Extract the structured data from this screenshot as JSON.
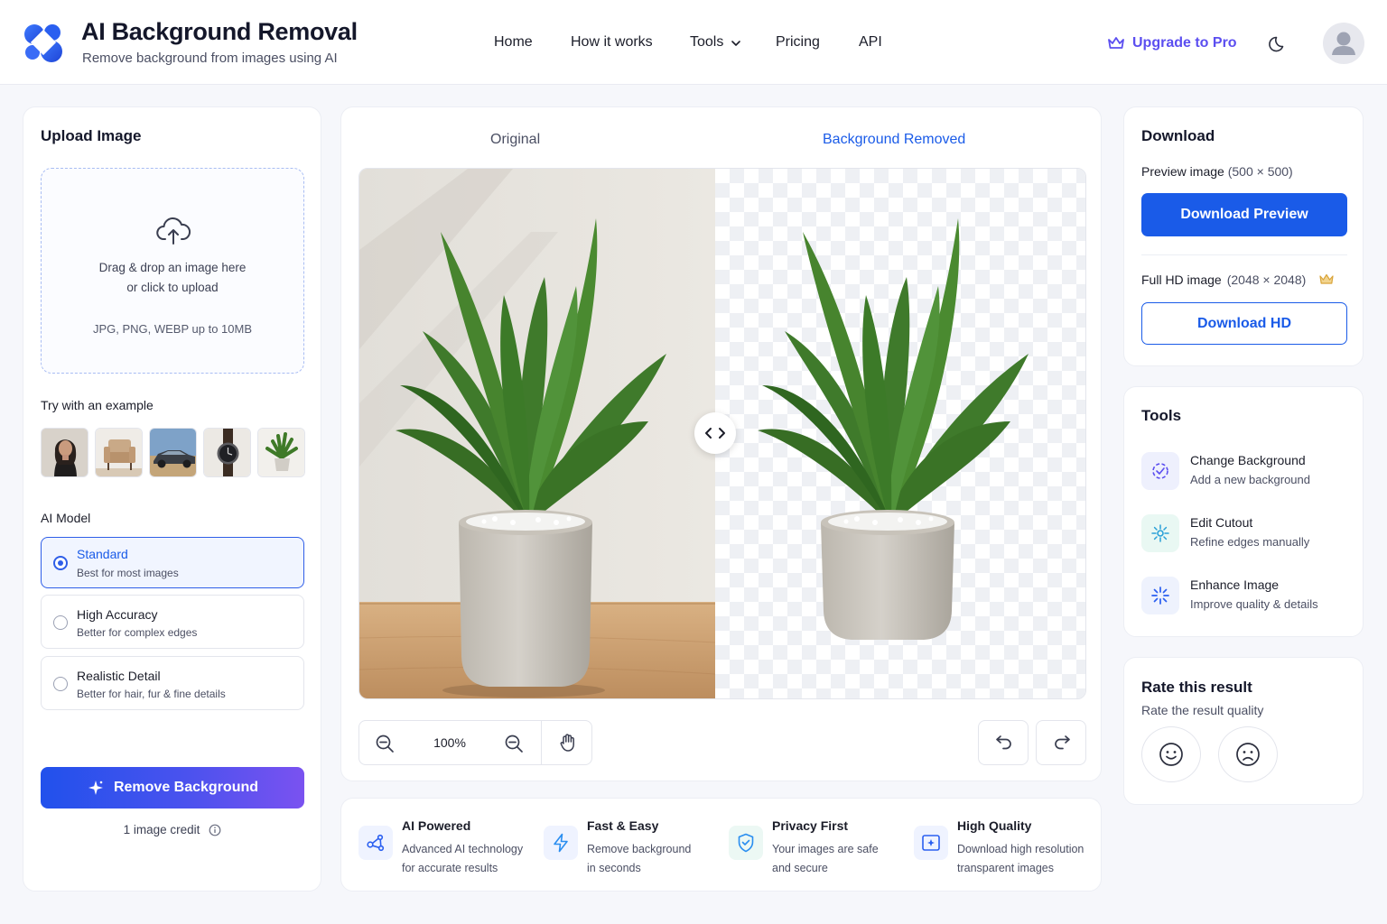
{
  "header": {
    "title": "AI Background Removal",
    "subtitle": "Remove background from images using AI",
    "nav": [
      {
        "label": "Home"
      },
      {
        "label": "How it works"
      },
      {
        "label": "Tools"
      },
      {
        "label": "Pricing"
      },
      {
        "label": "API"
      }
    ],
    "upgrade_label": "Upgrade to Pro",
    "accent_color": "#5b4ef0"
  },
  "upload": {
    "title": "Upload Image",
    "drop_line1": "Drag & drop an image here",
    "drop_line2": "or click to upload",
    "formats": "JPG, PNG, WEBP up to 10MB",
    "examples_label": "Try with an example",
    "examples": [
      "woman portrait",
      "armchair",
      "car",
      "watch",
      "potted plant"
    ]
  },
  "model": {
    "label": "AI Model",
    "options": [
      {
        "title": "Standard",
        "subtitle": "Best for most images",
        "selected": true
      },
      {
        "title": "High Accuracy",
        "subtitle": "Better for complex edges",
        "selected": false
      },
      {
        "title": "Realistic Detail",
        "subtitle": "Better for hair, fur & fine details",
        "selected": false
      }
    ]
  },
  "action": {
    "remove_label": "Remove Background",
    "credit_text": "1 image credit"
  },
  "preview": {
    "tab_original": "Original",
    "tab_removed": "Background Removed",
    "zoom": "100%",
    "active_color": "#1a5be8"
  },
  "features": [
    {
      "title": "AI Powered",
      "desc_line1": "Advanced AI technology",
      "desc_line2": "for accurate results",
      "icon": "ai-network-icon"
    },
    {
      "title": "Fast & Easy",
      "desc_line1": "Remove background",
      "desc_line2": "in seconds",
      "icon": "lightning-icon"
    },
    {
      "title": "Privacy First",
      "desc_line1": "Your images are safe",
      "desc_line2": "and secure",
      "icon": "shield-icon"
    },
    {
      "title": "High Quality",
      "desc_line1": "Download high resolution",
      "desc_line2": "transparent images",
      "icon": "hd-image-icon"
    }
  ],
  "download": {
    "title": "Download",
    "preview_label": "Preview image",
    "preview_size": "(500 × 500)",
    "preview_button": "Download Preview",
    "hd_label": "Full HD image",
    "hd_size": "(2048 × 2048)",
    "hd_button": "Download HD"
  },
  "tools": {
    "title": "Tools",
    "items": [
      {
        "title": "Change Background",
        "subtitle": "Add a new background",
        "icon": "background-swap-icon"
      },
      {
        "title": "Edit Cutout",
        "subtitle": "Refine edges manually",
        "icon": "edit-cutout-icon"
      },
      {
        "title": "Enhance Image",
        "subtitle": "Improve quality & details",
        "icon": "sparkle-enhance-icon"
      }
    ]
  },
  "rating": {
    "title": "Rate this result",
    "subtitle": "Rate the result quality"
  }
}
